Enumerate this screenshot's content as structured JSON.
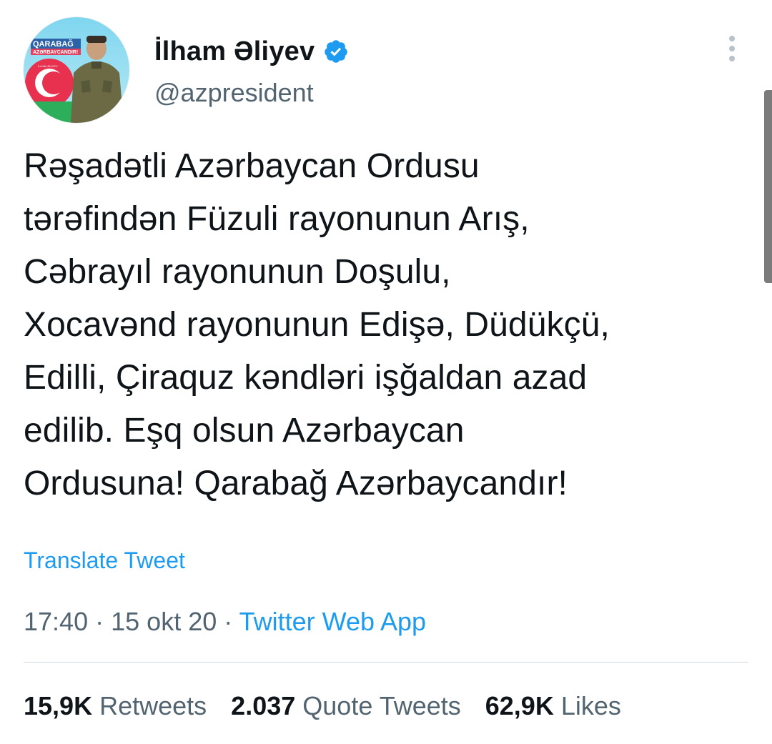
{
  "author": {
    "display_name": "İlham Əliyev",
    "handle": "@azpresident",
    "verified": true,
    "avatar": {
      "banner_line1": "QARABAĞ",
      "banner_line2": "AZƏRBAYCANDIR!",
      "badge_text": "İLHAM ƏLİYEV"
    }
  },
  "tweet": {
    "text": "Rəşadətli Azərbaycan Ordusu\ntərəfindən Füzuli rayonunun Arış,\nCəbrayıl rayonunun Doşulu,\nXocavənd rayonunun Edişə, Düdükçü,\nEdilli, Çiraquz kəndləri işğaldan azad\nedilib. Eşq olsun Azərbaycan\nOrdusuna! Qarabağ Azərbaycandır!",
    "translate_label": "Translate Tweet",
    "time": "17:40",
    "date": "15 okt 20",
    "separator": "·",
    "source": "Twitter Web App"
  },
  "stats": {
    "retweets_count": "15,9K",
    "retweets_label": "Retweets",
    "quotes_count": "2.037",
    "quotes_label": "Quote Tweets",
    "likes_count": "62,9K",
    "likes_label": "Likes"
  },
  "icons": {
    "verified": "verified-badge-icon",
    "more": "more-vertical-icon"
  },
  "colors": {
    "accent": "#1d9bf0",
    "text_primary": "#0f1419",
    "text_secondary": "#536471",
    "divider": "#cfd9de"
  }
}
